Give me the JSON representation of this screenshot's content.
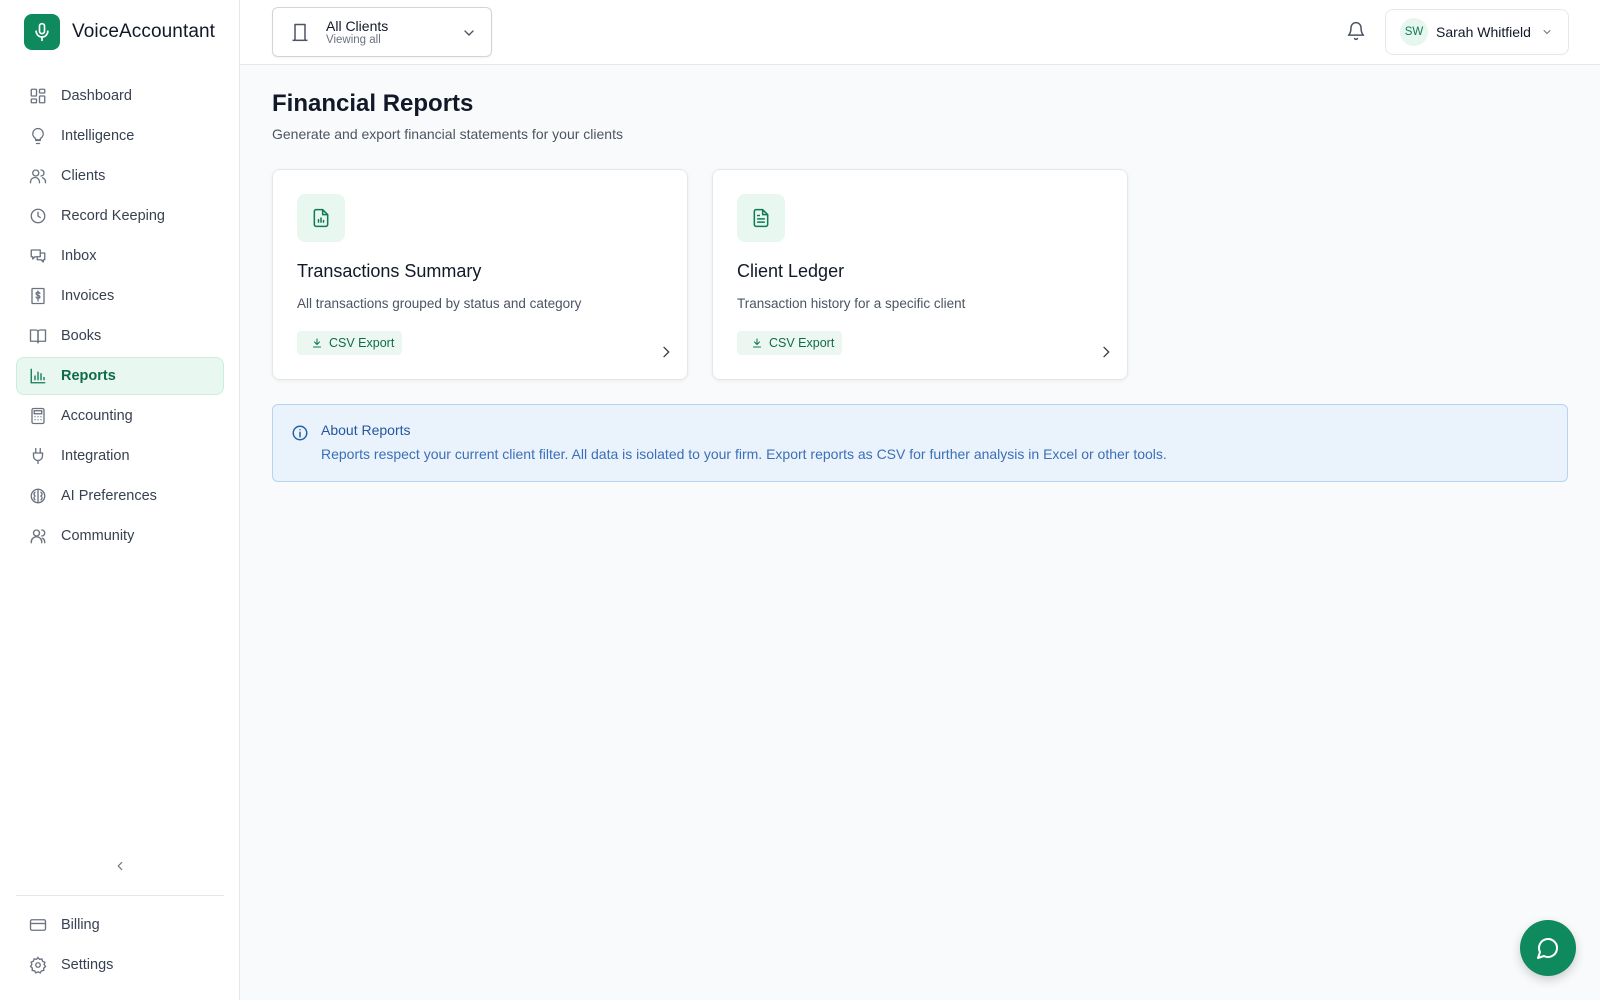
{
  "app": {
    "name": "VoiceAccountant",
    "logo_icon": "microphone-icon",
    "accent": "#0f8a5f"
  },
  "sidebar": {
    "items": [
      {
        "label": "Dashboard",
        "icon": "grid-icon"
      },
      {
        "label": "Intelligence",
        "icon": "lightbulb-icon"
      },
      {
        "label": "Clients",
        "icon": "users-icon"
      },
      {
        "label": "Record Keeping",
        "icon": "clock-icon"
      },
      {
        "label": "Inbox",
        "icon": "messages-icon"
      },
      {
        "label": "Invoices",
        "icon": "receipt-icon"
      },
      {
        "label": "Books",
        "icon": "book-open-icon"
      },
      {
        "label": "Reports",
        "icon": "bar-chart-icon",
        "active": true
      },
      {
        "label": "Accounting",
        "icon": "calculator-icon"
      },
      {
        "label": "Integration",
        "icon": "plug-icon"
      },
      {
        "label": "AI Preferences",
        "icon": "brain-icon"
      },
      {
        "label": "Community",
        "icon": "user-group-icon"
      }
    ],
    "collapse_icon": "chevron-left-icon",
    "bottom_items": [
      {
        "label": "Billing",
        "icon": "credit-card-icon"
      },
      {
        "label": "Settings",
        "icon": "gear-icon"
      }
    ]
  },
  "header": {
    "client_selector": {
      "title": "All Clients",
      "subtitle": "Viewing all",
      "icon": "building-icon"
    },
    "notification_icon": "bell-icon",
    "user": {
      "initials": "SW",
      "name": "Sarah Whitfield"
    }
  },
  "main": {
    "title": "Financial Reports",
    "subtitle": "Generate and export financial statements for your clients",
    "cards": [
      {
        "title": "Transactions Summary",
        "description": "All transactions grouped by status and category",
        "badge": "CSV Export",
        "icon": "file-chart-icon"
      },
      {
        "title": "Client Ledger",
        "description": "Transaction history for a specific client",
        "badge": "CSV Export",
        "icon": "file-text-icon"
      }
    ],
    "info": {
      "title": "About Reports",
      "text": "Reports respect your current client filter. All data is isolated to your firm. Export reports as CSV for further analysis in Excel or other tools."
    }
  },
  "chat_icon": "chat-bubble-icon"
}
